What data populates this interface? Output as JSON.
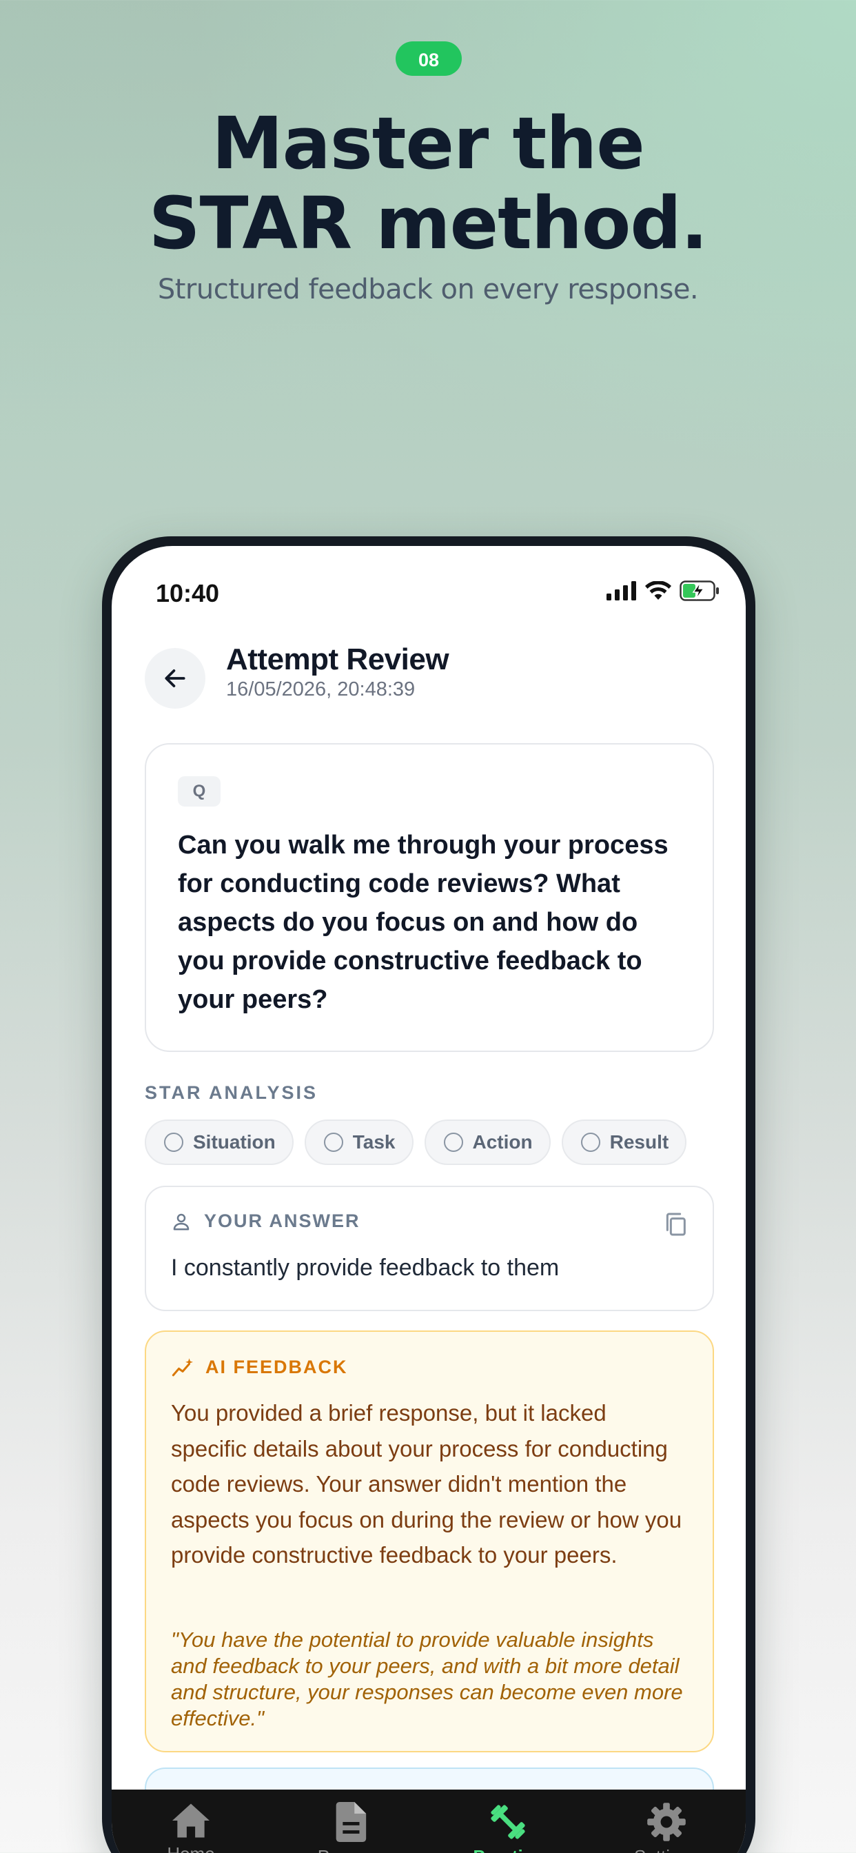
{
  "promo": {
    "step_badge": "08",
    "headline_line1": "Master the",
    "headline_line2": "STAR method.",
    "subhead": "Structured feedback on every response."
  },
  "status_bar": {
    "time": "10:40",
    "icons": [
      "signal-icon",
      "wifi-icon",
      "battery-charging-icon"
    ]
  },
  "header": {
    "back_icon": "arrow-left-icon",
    "title": "Attempt Review",
    "timestamp": "16/05/2026, 20:48:39"
  },
  "question": {
    "badge": "Q",
    "text": "Can you walk me through your process for conducting code reviews? What aspects do you focus on and how do you provide constructive feedback to your peers?"
  },
  "star_analysis": {
    "label": "STAR ANALYSIS",
    "chips": [
      {
        "label": "Situation",
        "checked": false
      },
      {
        "label": "Task",
        "checked": false
      },
      {
        "label": "Action",
        "checked": false
      },
      {
        "label": "Result",
        "checked": false
      }
    ]
  },
  "answer": {
    "label": "YOUR ANSWER",
    "text": "I constantly provide feedback to them",
    "icon": "user-icon",
    "copy_icon": "copy-icon"
  },
  "ai_feedback": {
    "label": "AI FEEDBACK",
    "icon": "sparkline-icon",
    "text": "You provided a brief response, but it lacked specific details about your process for conducting code reviews. Your answer didn't mention the aspects you focus on during the review or how you provide constructive feedback to your peers.",
    "quote": "\"You have the potential to provide valuable insights and feedback to your peers, and with a bit more detail and structure, your responses can become even more effective.\""
  },
  "tab_bar": {
    "tabs": [
      {
        "label": "Home",
        "icon": "home-icon",
        "active": false
      },
      {
        "label": "Prepare",
        "icon": "document-icon",
        "active": false
      },
      {
        "label": "Practice",
        "icon": "dumbbell-icon",
        "active": true
      },
      {
        "label": "Settings",
        "icon": "gear-icon",
        "active": false
      }
    ]
  },
  "colors": {
    "accent_green": "#22c55e",
    "active_tab": "#4ade80",
    "feedback_title": "#d97706",
    "feedback_bg": "#fefaeb"
  }
}
